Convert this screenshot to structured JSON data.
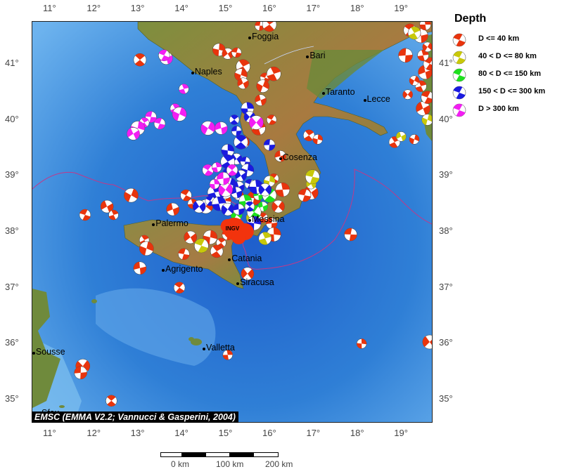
{
  "map": {
    "lon_range": [
      10.6,
      19.7
    ],
    "lat_range": [
      34.6,
      41.75
    ],
    "lon_ticks": [
      "11°",
      "12°",
      "13°",
      "14°",
      "15°",
      "16°",
      "17°",
      "18°",
      "19°"
    ],
    "lat_ticks": [
      "35°",
      "36°",
      "37°",
      "38°",
      "39°",
      "40°",
      "41°"
    ],
    "colors": {
      "sea": "#2f7fd6",
      "land_low": "#6f8a3c",
      "land_high": "#b5793f",
      "border": "#c0398a",
      "credit_bg": "#000000"
    }
  },
  "cities": [
    {
      "name": "Foggia",
      "lon": 15.55,
      "lat": 41.46
    },
    {
      "name": "Bari",
      "lon": 16.87,
      "lat": 41.12
    },
    {
      "name": "Naples",
      "lon": 14.25,
      "lat": 40.84
    },
    {
      "name": "Taranto",
      "lon": 17.23,
      "lat": 40.47
    },
    {
      "name": "Lecce",
      "lon": 18.17,
      "lat": 40.35
    },
    {
      "name": "Cosenza",
      "lon": 16.25,
      "lat": 39.3
    },
    {
      "name": "Palermo",
      "lon": 13.36,
      "lat": 38.12
    },
    {
      "name": "Messina",
      "lon": 15.55,
      "lat": 38.2
    },
    {
      "name": "Catania",
      "lon": 15.09,
      "lat": 37.5
    },
    {
      "name": "Agrigento",
      "lon": 13.58,
      "lat": 37.31
    },
    {
      "name": "Siracusa",
      "lon": 15.28,
      "lat": 37.07
    },
    {
      "name": "Valletta",
      "lon": 14.51,
      "lat": 35.9
    },
    {
      "name": "Sousse",
      "lon": 10.63,
      "lat": 35.83
    },
    {
      "name": "Sfax",
      "lon": 10.76,
      "lat": 34.74
    }
  ],
  "ingv_label": "INGV",
  "credit": "EMSC (EMMA V2.2; Vannucci & Gasperini, 2004)",
  "legend": {
    "title": "Depth",
    "items": [
      {
        "label": "D <= 40 km",
        "color": "#e8340d"
      },
      {
        "label": "40 < D <= 80 km",
        "color": "#c8c80a"
      },
      {
        "label": "80 < D <= 150 km",
        "color": "#1ee01e"
      },
      {
        "label": "150 < D <= 300 km",
        "color": "#1a1ae0"
      },
      {
        "label": "D > 300 km",
        "color": "#f21ef2"
      }
    ]
  },
  "scale": {
    "labels": [
      "0 km",
      "100 km",
      "200 km"
    ]
  },
  "events": [
    {
      "lon": 15.78,
      "lat": 41.68,
      "d": 0
    },
    {
      "lon": 16.0,
      "lat": 41.7,
      "d": 0
    },
    {
      "lon": 14.85,
      "lat": 41.25,
      "d": 0
    },
    {
      "lon": 15.05,
      "lat": 41.18,
      "d": 0
    },
    {
      "lon": 15.25,
      "lat": 41.2,
      "d": 0
    },
    {
      "lon": 15.4,
      "lat": 40.95,
      "d": 0
    },
    {
      "lon": 15.35,
      "lat": 40.8,
      "d": 0
    },
    {
      "lon": 15.4,
      "lat": 40.65,
      "d": 0
    },
    {
      "lon": 15.9,
      "lat": 40.75,
      "d": 0
    },
    {
      "lon": 16.1,
      "lat": 40.82,
      "d": 0
    },
    {
      "lon": 15.85,
      "lat": 40.6,
      "d": 0
    },
    {
      "lon": 15.8,
      "lat": 40.35,
      "d": 0
    },
    {
      "lon": 16.05,
      "lat": 40.0,
      "d": 0
    },
    {
      "lon": 15.75,
      "lat": 39.85,
      "d": 0
    },
    {
      "lon": 15.4,
      "lat": 39.6,
      "d": 0
    },
    {
      "lon": 16.25,
      "lat": 39.35,
      "d": 0
    },
    {
      "lon": 16.1,
      "lat": 38.95,
      "d": 0
    },
    {
      "lon": 16.3,
      "lat": 38.75,
      "d": 0
    },
    {
      "lon": 16.2,
      "lat": 38.45,
      "d": 0
    },
    {
      "lon": 16.05,
      "lat": 38.15,
      "d": 0
    },
    {
      "lon": 15.85,
      "lat": 38.25,
      "d": 0
    },
    {
      "lon": 16.1,
      "lat": 37.95,
      "d": 0
    },
    {
      "lon": 15.5,
      "lat": 37.25,
      "d": 0
    },
    {
      "lon": 15.05,
      "lat": 37.95,
      "d": 0
    },
    {
      "lon": 14.9,
      "lat": 37.8,
      "d": 0
    },
    {
      "lon": 14.65,
      "lat": 37.9,
      "d": 0
    },
    {
      "lon": 14.2,
      "lat": 37.9,
      "d": 0
    },
    {
      "lon": 14.05,
      "lat": 37.6,
      "d": 0
    },
    {
      "lon": 13.15,
      "lat": 37.85,
      "d": 0
    },
    {
      "lon": 13.2,
      "lat": 37.7,
      "d": 0
    },
    {
      "lon": 12.3,
      "lat": 38.45,
      "d": 0
    },
    {
      "lon": 11.8,
      "lat": 38.3,
      "d": 0
    },
    {
      "lon": 12.45,
      "lat": 38.3,
      "d": 0
    },
    {
      "lon": 12.85,
      "lat": 38.65,
      "d": 0
    },
    {
      "lon": 13.8,
      "lat": 38.4,
      "d": 0
    },
    {
      "lon": 14.1,
      "lat": 38.65,
      "d": 0
    },
    {
      "lon": 14.25,
      "lat": 38.5,
      "d": 0
    },
    {
      "lon": 14.55,
      "lat": 38.45,
      "d": 0
    },
    {
      "lon": 13.05,
      "lat": 37.35,
      "d": 0
    },
    {
      "lon": 13.95,
      "lat": 37.0,
      "d": 0
    },
    {
      "lon": 15.05,
      "lat": 35.8,
      "d": 0
    },
    {
      "lon": 11.75,
      "lat": 35.6,
      "d": 0
    },
    {
      "lon": 11.7,
      "lat": 35.48,
      "d": 0
    },
    {
      "lon": 12.4,
      "lat": 34.98,
      "d": 0
    },
    {
      "lon": 18.1,
      "lat": 36.0,
      "d": 0
    },
    {
      "lon": 19.65,
      "lat": 36.03,
      "d": 0
    },
    {
      "lon": 17.85,
      "lat": 37.95,
      "d": 0
    },
    {
      "lon": 16.9,
      "lat": 39.72,
      "d": 0
    },
    {
      "lon": 17.1,
      "lat": 39.65,
      "d": 0
    },
    {
      "lon": 16.95,
      "lat": 38.7,
      "d": 0
    },
    {
      "lon": 16.8,
      "lat": 38.65,
      "d": 0
    },
    {
      "lon": 18.85,
      "lat": 39.6,
      "d": 0
    },
    {
      "lon": 19.3,
      "lat": 39.65,
      "d": 0
    },
    {
      "lon": 19.5,
      "lat": 40.2,
      "d": 0
    },
    {
      "lon": 19.6,
      "lat": 40.4,
      "d": 0
    },
    {
      "lon": 19.45,
      "lat": 40.6,
      "d": 0
    },
    {
      "lon": 19.3,
      "lat": 40.7,
      "d": 0
    },
    {
      "lon": 19.55,
      "lat": 40.85,
      "d": 0
    },
    {
      "lon": 19.65,
      "lat": 41.0,
      "d": 0
    },
    {
      "lon": 19.5,
      "lat": 41.15,
      "d": 0
    },
    {
      "lon": 19.6,
      "lat": 41.3,
      "d": 0
    },
    {
      "lon": 19.45,
      "lat": 41.5,
      "d": 0
    },
    {
      "lon": 19.2,
      "lat": 41.6,
      "d": 0
    },
    {
      "lon": 19.55,
      "lat": 41.7,
      "d": 0
    },
    {
      "lon": 19.15,
      "lat": 40.45,
      "d": 0
    },
    {
      "lon": 19.1,
      "lat": 41.15,
      "d": 0
    },
    {
      "lon": 13.05,
      "lat": 41.07,
      "d": 0
    },
    {
      "lon": 15.0,
      "lat": 38.55,
      "d": 0
    },
    {
      "lon": 15.3,
      "lat": 38.65,
      "d": 0
    },
    {
      "lon": 15.65,
      "lat": 38.6,
      "d": 0
    },
    {
      "lon": 14.8,
      "lat": 37.65,
      "d": 0
    },
    {
      "lon": 16.0,
      "lat": 38.9,
      "d": 1
    },
    {
      "lon": 16.95,
      "lat": 38.85,
      "d": 1
    },
    {
      "lon": 16.98,
      "lat": 38.98,
      "d": 1
    },
    {
      "lon": 19.3,
      "lat": 41.55,
      "d": 1
    },
    {
      "lon": 19.6,
      "lat": 40.0,
      "d": 1
    },
    {
      "lon": 19.0,
      "lat": 39.7,
      "d": 1
    },
    {
      "lon": 14.45,
      "lat": 37.75,
      "d": 1
    },
    {
      "lon": 15.9,
      "lat": 37.88,
      "d": 1
    },
    {
      "lon": 15.6,
      "lat": 38.25,
      "d": 1
    },
    {
      "lon": 15.85,
      "lat": 38.45,
      "d": 2
    },
    {
      "lon": 15.65,
      "lat": 38.35,
      "d": 2
    },
    {
      "lon": 15.45,
      "lat": 38.55,
      "d": 2
    },
    {
      "lon": 15.25,
      "lat": 38.3,
      "d": 2
    },
    {
      "lon": 15.75,
      "lat": 38.65,
      "d": 2
    },
    {
      "lon": 16.0,
      "lat": 38.65,
      "d": 2
    },
    {
      "lon": 15.5,
      "lat": 40.2,
      "d": 3
    },
    {
      "lon": 15.55,
      "lat": 40.05,
      "d": 3
    },
    {
      "lon": 15.25,
      "lat": 39.8,
      "d": 3
    },
    {
      "lon": 15.35,
      "lat": 39.6,
      "d": 3
    },
    {
      "lon": 15.05,
      "lat": 39.45,
      "d": 3
    },
    {
      "lon": 15.25,
      "lat": 39.3,
      "d": 3
    },
    {
      "lon": 15.45,
      "lat": 39.25,
      "d": 3
    },
    {
      "lon": 15.05,
      "lat": 39.25,
      "d": 3
    },
    {
      "lon": 15.5,
      "lat": 39.1,
      "d": 3
    },
    {
      "lon": 15.35,
      "lat": 39.0,
      "d": 3
    },
    {
      "lon": 15.05,
      "lat": 39.05,
      "d": 3
    },
    {
      "lon": 14.9,
      "lat": 38.9,
      "d": 3
    },
    {
      "lon": 15.1,
      "lat": 38.85,
      "d": 3
    },
    {
      "lon": 15.3,
      "lat": 38.8,
      "d": 3
    },
    {
      "lon": 15.55,
      "lat": 38.85,
      "d": 3
    },
    {
      "lon": 14.75,
      "lat": 38.7,
      "d": 3
    },
    {
      "lon": 15.0,
      "lat": 38.7,
      "d": 3
    },
    {
      "lon": 15.25,
      "lat": 38.7,
      "d": 3
    },
    {
      "lon": 14.65,
      "lat": 38.55,
      "d": 3
    },
    {
      "lon": 14.85,
      "lat": 38.5,
      "d": 3
    },
    {
      "lon": 15.05,
      "lat": 38.4,
      "d": 3
    },
    {
      "lon": 15.3,
      "lat": 38.4,
      "d": 3
    },
    {
      "lon": 15.55,
      "lat": 38.45,
      "d": 3
    },
    {
      "lon": 15.7,
      "lat": 38.8,
      "d": 3
    },
    {
      "lon": 15.9,
      "lat": 38.75,
      "d": 3
    },
    {
      "lon": 16.0,
      "lat": 39.55,
      "d": 3
    },
    {
      "lon": 15.2,
      "lat": 40.0,
      "d": 3
    },
    {
      "lon": 15.65,
      "lat": 38.15,
      "d": 3
    },
    {
      "lon": 14.4,
      "lat": 38.45,
      "d": 3
    },
    {
      "lon": 13.3,
      "lat": 40.05,
      "d": 4
    },
    {
      "lon": 13.15,
      "lat": 39.95,
      "d": 4
    },
    {
      "lon": 13.0,
      "lat": 39.85,
      "d": 4
    },
    {
      "lon": 12.9,
      "lat": 39.75,
      "d": 4
    },
    {
      "lon": 13.5,
      "lat": 39.93,
      "d": 4
    },
    {
      "lon": 13.85,
      "lat": 40.2,
      "d": 4
    },
    {
      "lon": 13.95,
      "lat": 40.1,
      "d": 4
    },
    {
      "lon": 13.65,
      "lat": 41.1,
      "d": 4
    },
    {
      "lon": 13.6,
      "lat": 41.15,
      "d": 4
    },
    {
      "lon": 14.05,
      "lat": 40.55,
      "d": 4
    },
    {
      "lon": 14.6,
      "lat": 39.85,
      "d": 4
    },
    {
      "lon": 14.9,
      "lat": 39.85,
      "d": 4
    },
    {
      "lon": 14.6,
      "lat": 39.1,
      "d": 4
    },
    {
      "lon": 14.8,
      "lat": 39.15,
      "d": 4
    },
    {
      "lon": 15.0,
      "lat": 38.75,
      "d": 4
    },
    {
      "lon": 14.95,
      "lat": 38.95,
      "d": 4
    },
    {
      "lon": 15.15,
      "lat": 39.1,
      "d": 4
    },
    {
      "lon": 14.75,
      "lat": 38.85,
      "d": 4
    },
    {
      "lon": 15.7,
      "lat": 39.95,
      "d": 4
    }
  ]
}
